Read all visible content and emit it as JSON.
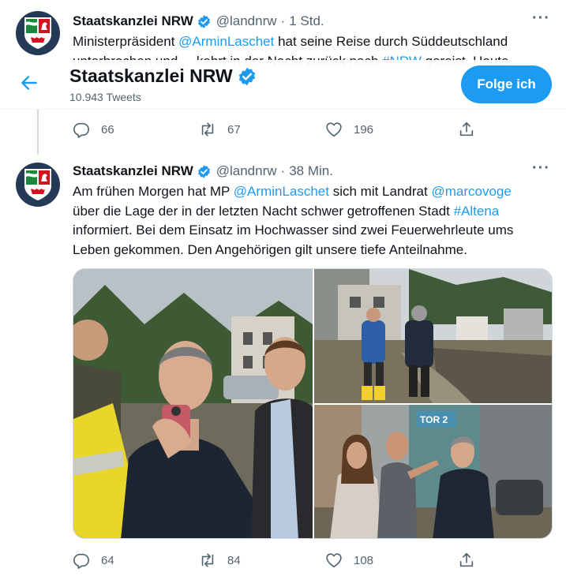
{
  "tweet1": {
    "name": "Staatskanzlei NRW",
    "handle": "@landnrw",
    "time": "1 Std.",
    "text_part1": "Ministerpräsident ",
    "mention": "@ArminLaschet",
    "text_part2": " hat seine Reise durch Süddeutschland",
    "text_line2_part1": "unterbrochen und ... kehrt in der Nacht zurück nach ",
    "hashtag": "#NRW",
    "text_line2_part2": " gereist. Heute",
    "replies": "66",
    "retweets": "67",
    "likes": "196"
  },
  "header": {
    "title": "Staatskanzlei NRW",
    "tweet_count": "10.943 Tweets",
    "follow_label": "Folge ich"
  },
  "tweet2": {
    "name": "Staatskanzlei NRW",
    "handle": "@landnrw",
    "time": "38 Min.",
    "line1_a": "Am frühen Morgen hat MP ",
    "line1_mention1": "@ArminLaschet",
    "line1_b": " sich mit Landrat ",
    "line1_mention2": "@marcovoge",
    "line2_a": "über die Lage der in der letzten Nacht schwer getroffenen Stadt ",
    "line2_hashtag": "#Altena",
    "line3": "informiert. Bei dem Einsatz im Hochwasser sind zwei Feuerwehrleute ums",
    "line4": "Leben gekommen. Den Angehörigen gilt unsere tiefe Anteilnahme.",
    "photo_sign_text": "TOR 2",
    "replies": "64",
    "retweets": "84",
    "likes": "108"
  },
  "icons": {
    "more": "more-horizontal-icon",
    "reply": "reply-icon",
    "retweet": "retweet-icon",
    "like": "heart-icon",
    "share": "share-icon",
    "back": "back-arrow-icon",
    "verified": "verified-badge-icon"
  },
  "colors": {
    "accent": "#1d9bf0",
    "secondary_text": "#536471",
    "avatar_bg": "#243a57"
  }
}
